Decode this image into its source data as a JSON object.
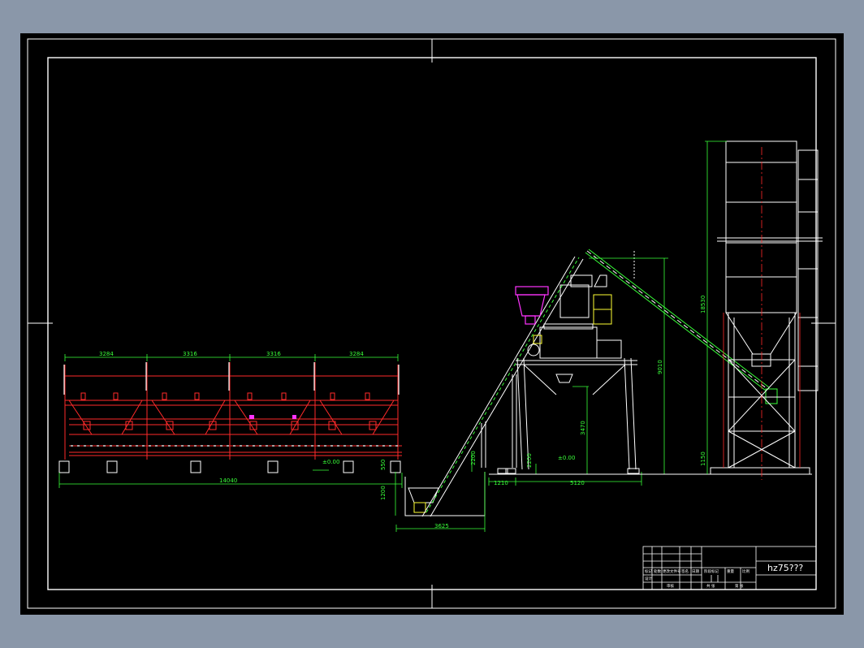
{
  "drawing": {
    "title_block_name": "hz75???",
    "dimensions": {
      "bin_span_1": "3284",
      "bin_span_2": "3316",
      "bin_span_3": "3316",
      "bin_span_4": "3284",
      "total_length": "14040",
      "belt_run": "3625",
      "pit_depth": "1200",
      "pit_step": "550",
      "gap_a": "1210",
      "gap_b": "5120",
      "mixer_height": "9010",
      "discharge_height": "3470",
      "leg_height": "2200",
      "foot_height": "2200",
      "silo_height": "18530",
      "silo_base": "1150",
      "level_left": "±0.00",
      "level_right": "±0.00"
    },
    "title_block": {
      "cell_1": "标记",
      "cell_2": "处数",
      "cell_3": "更改文件号",
      "cell_4": "签名",
      "cell_5": "日期",
      "cell_6": "设计",
      "cell_7": "审核",
      "cell_8": "阶段标记",
      "cell_9": "重量",
      "cell_10": "比例",
      "cell_11": "共 张",
      "cell_12": "第 张"
    }
  },
  "colors": {
    "background": "#000000",
    "frame": "#ffffff",
    "dimension": "#39ff39",
    "bin_frame": "#ff2a2a",
    "machine": "#ffffff",
    "hopper": "#ff33ff",
    "motor": "#ffff33",
    "axis": "#ff2a2a",
    "outer": "#8a97a9"
  }
}
